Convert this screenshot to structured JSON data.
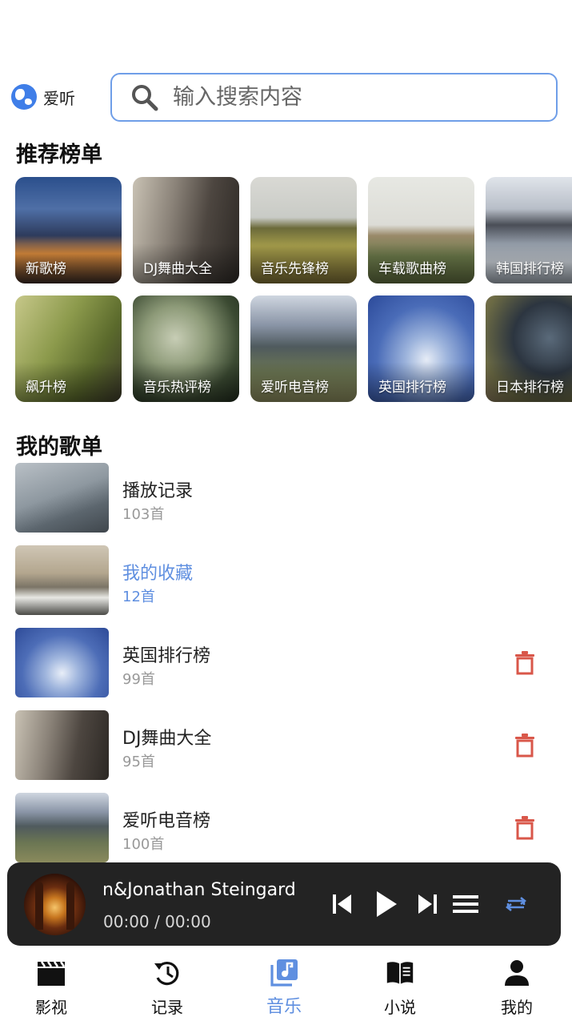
{
  "brand": {
    "label": "爱听"
  },
  "search": {
    "placeholder": "输入搜索内容"
  },
  "recommended": {
    "title": "推荐榜单",
    "tiles": [
      {
        "label": "新歌榜"
      },
      {
        "label": "DJ舞曲大全"
      },
      {
        "label": "音乐先锋榜"
      },
      {
        "label": "车载歌曲榜"
      },
      {
        "label": "韩国排行榜"
      },
      {
        "label": "飙升榜"
      },
      {
        "label": "音乐热评榜"
      },
      {
        "label": "爱听电音榜"
      },
      {
        "label": "英国排行榜"
      },
      {
        "label": "日本排行榜"
      }
    ]
  },
  "my_playlists": {
    "title": "我的歌单",
    "items": [
      {
        "name": "播放记录",
        "count": "103首"
      },
      {
        "name": "我的收藏",
        "count": "12首"
      },
      {
        "name": "英国排行榜",
        "count": "99首"
      },
      {
        "name": "DJ舞曲大全",
        "count": "95首"
      },
      {
        "name": "爱听电音榜",
        "count": "100首"
      }
    ]
  },
  "player": {
    "track": "Nelson&Jonathan Steingard",
    "time": "00:00 / 00:00"
  },
  "nav": [
    {
      "label": "影视",
      "icon": "clapperboard-icon"
    },
    {
      "label": "记录",
      "icon": "history-icon"
    },
    {
      "label": "音乐",
      "icon": "music-library-icon"
    },
    {
      "label": "小说",
      "icon": "book-icon"
    },
    {
      "label": "我的",
      "icon": "person-icon"
    }
  ],
  "colors": {
    "accent": "#5f8fe0",
    "delete": "#d9574a",
    "player_bg": "#232323"
  }
}
